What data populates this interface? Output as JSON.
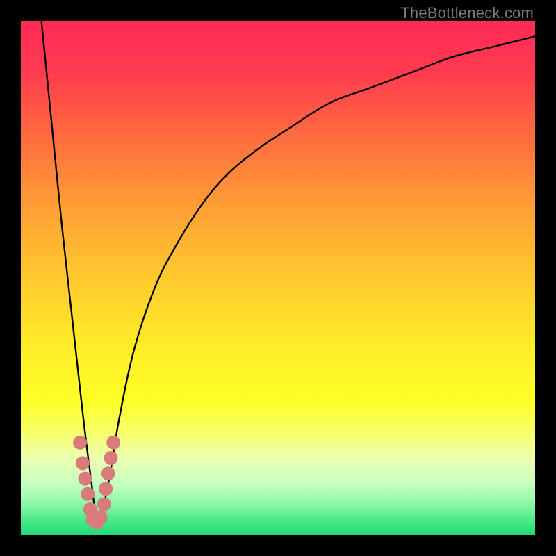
{
  "watermark": "TheBottleneck.com",
  "chart_data": {
    "type": "line",
    "title": "",
    "xlabel": "",
    "ylabel": "",
    "xlim": [
      0,
      100
    ],
    "ylim": [
      0,
      100
    ],
    "grid": false,
    "legend": false,
    "series": [
      {
        "name": "curve",
        "x": [
          4,
          6,
          8,
          10,
          12,
          13.5,
          15,
          17,
          19,
          22,
          26,
          30,
          35,
          40,
          46,
          52,
          60,
          68,
          76,
          84,
          92,
          100
        ],
        "y": [
          100,
          80,
          60,
          42,
          24,
          12,
          3,
          10,
          22,
          36,
          48,
          56,
          64,
          70,
          75,
          79,
          84,
          87,
          90,
          93,
          95,
          97
        ]
      }
    ],
    "annotations": {
      "dip_x": 14,
      "dip_y": 0,
      "highlight_points": [
        {
          "x": 11.5,
          "y": 18
        },
        {
          "x": 12.0,
          "y": 14
        },
        {
          "x": 12.5,
          "y": 11
        },
        {
          "x": 13.0,
          "y": 8
        },
        {
          "x": 13.5,
          "y": 5
        },
        {
          "x": 14.0,
          "y": 3
        },
        {
          "x": 14.8,
          "y": 2.5
        },
        {
          "x": 15.5,
          "y": 3.5
        },
        {
          "x": 16.2,
          "y": 6
        },
        {
          "x": 16.5,
          "y": 9
        },
        {
          "x": 17.0,
          "y": 12
        },
        {
          "x": 17.5,
          "y": 15
        },
        {
          "x": 18.0,
          "y": 18
        }
      ],
      "highlight_color": "#d97b7b"
    },
    "gradient_stops": [
      {
        "pos": 0.0,
        "color": "#ff2a57"
      },
      {
        "pos": 0.1,
        "color": "#ff3b4f"
      },
      {
        "pos": 0.22,
        "color": "#ff6a3f"
      },
      {
        "pos": 0.35,
        "color": "#ff9a36"
      },
      {
        "pos": 0.5,
        "color": "#ffca2e"
      },
      {
        "pos": 0.65,
        "color": "#fff028"
      },
      {
        "pos": 0.74,
        "color": "#fdff26"
      },
      {
        "pos": 0.8,
        "color": "#f6ff6a"
      },
      {
        "pos": 0.85,
        "color": "#ecffb0"
      },
      {
        "pos": 0.9,
        "color": "#c7ffc0"
      },
      {
        "pos": 0.94,
        "color": "#8cf7a6"
      },
      {
        "pos": 0.97,
        "color": "#4de989"
      },
      {
        "pos": 1.0,
        "color": "#1edc74"
      }
    ]
  }
}
